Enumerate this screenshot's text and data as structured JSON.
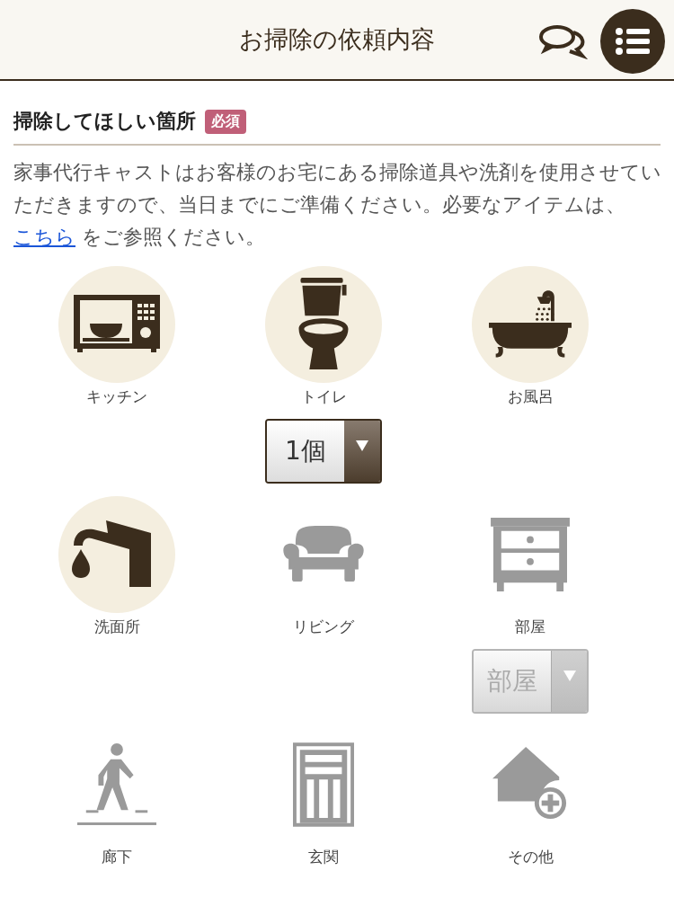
{
  "header": {
    "title": "お掃除の依頼内容"
  },
  "section": {
    "heading": "掃除してほしい箇所",
    "badge": "必須"
  },
  "intro": {
    "before": "家事代行キャストはお客様のお宅にある掃除道具や洗剤を使用させていただきますので、当日までにご準備ください。必要なアイテムは、",
    "link": "こちら",
    "after": " をご参照ください。"
  },
  "rows": [
    [
      {
        "kind": "microwave",
        "label": "キッチン",
        "selected": true
      },
      {
        "kind": "toilet",
        "label": "トイレ",
        "selected": true,
        "select": {
          "value": "1個",
          "disabled": false
        }
      },
      {
        "kind": "bath",
        "label": "お風呂",
        "selected": true
      }
    ],
    [
      {
        "kind": "faucet",
        "label": "洗面所",
        "selected": true
      },
      {
        "kind": "sofa",
        "label": "リビング",
        "selected": false
      },
      {
        "kind": "drawers",
        "label": "部屋",
        "selected": false,
        "select": {
          "value": "部屋",
          "disabled": true
        }
      }
    ],
    [
      {
        "kind": "walker",
        "label": "廊下",
        "selected": false
      },
      {
        "kind": "door",
        "label": "玄関",
        "selected": false
      },
      {
        "kind": "house-plus",
        "label": "その他",
        "selected": false
      }
    ]
  ]
}
